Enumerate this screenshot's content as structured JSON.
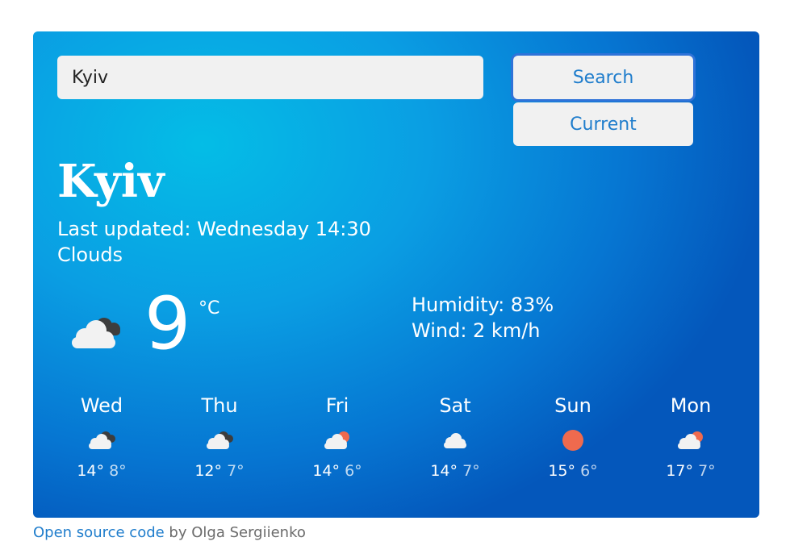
{
  "search": {
    "value": "Kyiv",
    "search_label": "Search",
    "current_label": "Current"
  },
  "current": {
    "city": "Kyiv",
    "last_updated": "Last updated: Wednesday 14:30",
    "description": "Clouds",
    "temperature": "9",
    "unit": "°C",
    "humidity": "Humidity: 83%",
    "wind": "Wind: 2 km/h",
    "icon": "broken-clouds-icon"
  },
  "forecast": [
    {
      "day": "Wed",
      "max": "14°",
      "min": "8°",
      "icon": "broken-clouds-icon"
    },
    {
      "day": "Thu",
      "max": "12°",
      "min": "7°",
      "icon": "broken-clouds-icon"
    },
    {
      "day": "Fri",
      "max": "14°",
      "min": "6°",
      "icon": "sun-behind-cloud-icon"
    },
    {
      "day": "Sat",
      "max": "14°",
      "min": "7°",
      "icon": "cloud-icon"
    },
    {
      "day": "Sun",
      "max": "15°",
      "min": "6°",
      "icon": "sun-icon"
    },
    {
      "day": "Mon",
      "max": "17°",
      "min": "7°",
      "icon": "sun-behind-cloud-icon"
    }
  ],
  "footer": {
    "link_text": "Open source code",
    "suffix": " by Olga Sergiienko"
  },
  "colors": {
    "accent": "#1f7dcc",
    "sun": "#ef6a4e",
    "dark_cloud": "#3d3d3d"
  }
}
